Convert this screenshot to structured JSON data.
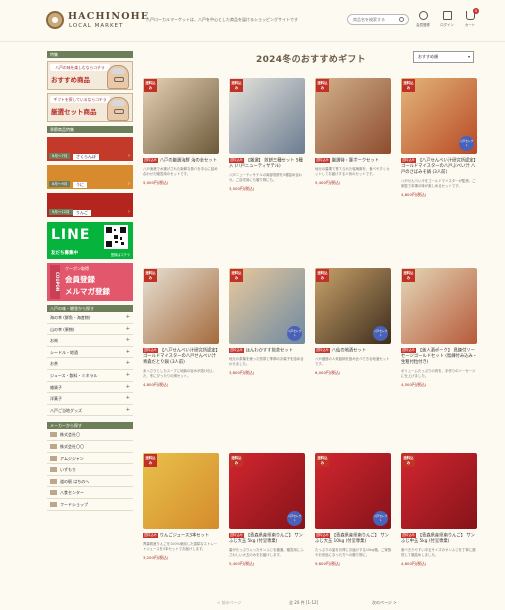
{
  "header": {
    "logo_main": "HACHINOHE",
    "logo_sub": "LOCAL MARKET",
    "description": "八戸ローカルマーケットは、八戸を中心とした商品を届けるショッピングサイトです",
    "search_placeholder": "商品名を検索する",
    "icons": [
      {
        "name": "user-icon",
        "label": "会員登録"
      },
      {
        "name": "logout-icon",
        "label": "ログイン"
      },
      {
        "name": "cart-icon",
        "label": "カート",
        "badge": "0"
      }
    ]
  },
  "sidebar": {
    "feature_head": "特集",
    "banners": [
      {
        "top": "八戸の味を楽しむならコチラ",
        "big": "おすすめ商品"
      },
      {
        "top": "ギフトを探しているならコチラ",
        "big": "厳選セット商品"
      }
    ],
    "season_head": "季節商品特集",
    "seasons": [
      {
        "period": "6月〜7月",
        "name": "さくらんぼ",
        "color": "#c43a2a"
      },
      {
        "period": "8月〜9月",
        "name": "うに",
        "color": "#d88a2e"
      },
      {
        "period": "9月〜12月",
        "name": "りんご",
        "color": "#b5251f"
      }
    ],
    "line": {
      "word": "LINE",
      "bottom": "友だち募集中",
      "qr_caption": "登録はコチラ"
    },
    "coupon": {
      "vertical": "COUPON",
      "top": "クーポン取得",
      "l1": "会員登録",
      "l2": "メルマガ登録"
    },
    "category_head": "八戸の味・贈答から探す",
    "categories": [
      "海の幸 (鮮魚・海産物)",
      "山の幸 (果物)",
      "お肉",
      "シードル・地酒",
      "お茶",
      "ジュース・飲料・ミネラル",
      "雑貨子",
      "洋菓子",
      "八戸ご当地グッズ"
    ],
    "maker_head": "メーカーから探す",
    "makers": [
      "株式会社〇",
      "株式会社〇〇",
      "アムジジャン",
      "いずもり",
      "道の駅 はちのへ",
      "八食センター",
      "フードショップ"
    ]
  },
  "main": {
    "title": "2024冬のおすすめギフト",
    "sort_label": "おすすめ順",
    "ribbon_text": "送料込み",
    "tag_text": "送料込み",
    "stamp_text": "八戸セレクト",
    "products": [
      {
        "name": "八戸の厳選海鮮 海の幸セット",
        "desc": "八戸漁港で水揚げされた新鮮な魚介を中心に詰め合わせた贈答用のセットです。",
        "price": "5,000円(税込)",
        "colors": [
          "#e9d1b6",
          "#6b5a3a"
        ],
        "stamp": false
      },
      {
        "name": "【厳選】 煎餅三種セット 5種入 (八戸ニューティサテル)",
        "desc": "八戸ニューティサテルの南部煎餅を5種詰め合わせ。ご自宅用にも贈り物にも。",
        "price": "3,500円(税込)",
        "colors": [
          "#e7e4dd",
          "#6c7d91"
        ],
        "stamp": false
      },
      {
        "name": "厳選特・豚ボークセット",
        "desc": "地元の農場で育てられた銘柄豚を、食べやすくカットしてお届けする人気のセットです。",
        "price": "5,400円(税込)",
        "colors": [
          "#d3b38c",
          "#8d4c2f"
        ],
        "stamp": false
      },
      {
        "name": "【八戸せんべい汁研究所認定】 ゴールドマイスターの八戸ぶべい汁 八戸のさばみそ鍋 (3人前)",
        "desc": "八戸せんべい汁をゴールドマイスターが監修。ご家庭で本場の味が楽しめるセットです。",
        "price": "4,800円(税込)",
        "colors": [
          "#e3b67a",
          "#b84a25"
        ],
        "stamp": true
      },
      {
        "name": "【八戸せんべい汁研究所認定】 ゴールドマイスターの八戸せんべい汁 青森だとり鍋 (3人前)",
        "desc": "あっさりとしたスープに地鶏の旨みが溶け出した、冬にぴったりの鍋セット。",
        "price": "4,800円(税込)",
        "colors": [
          "#e8e0d4",
          "#a36b3d"
        ],
        "stamp": false
      },
      {
        "name": "ほんわかすす煎茶セット",
        "desc": "地元の茶葉を使った煎茶と季節のお菓子を詰め合わせました。",
        "price": "3,800円(税込)",
        "colors": [
          "#e9c99b",
          "#6e8aa3"
        ],
        "stamp": true
      },
      {
        "name": "八仙の地酒セット",
        "desc": "八戸酒造の人気銘柄を飲み比べできる地酒セットです。",
        "price": "6,000円(税込)",
        "colors": [
          "#c9a26a",
          "#3d2d1d"
        ],
        "stamp": true
      },
      {
        "name": "【美人酒ポーク】 鳥練付ソーセージゴールドセット (鳥練付み込み・生粗付粒付き)",
        "desc": "ボリュームたっぷりの肉を、手作りのソーセージに仕上げました。",
        "price": "4,500円(税込)",
        "colors": [
          "#e4d8b8",
          "#b65a3a"
        ],
        "stamp": false
      },
      {
        "name": "りんごジュース3本セット",
        "desc": "青森県産りんごを100%使用した濃厚なストレートジュースを3本セットでお届けします。",
        "price": "3,200円(税込)",
        "colors": [
          "#e8c14b",
          "#d58b2c"
        ],
        "stamp": false
      },
      {
        "name": "【青森県産県南りんご】 サンふじ大玉 5kg (付呈専業)",
        "desc": "蜜がたっぷり入ったサンふじを厳選。贈答用にふさわしい大玉のみをお届けします。",
        "price": "5,400円(税込)",
        "colors": [
          "#d2262f",
          "#86131a"
        ],
        "stamp": true
      },
      {
        "name": "【青森県産県南りんご】 サンふじ大玉 10kg (付呈専業)",
        "desc": "たっぷりの量をお得にお届けする10kg箱。ご家族やお世話になった方への贈り物に。",
        "price": "9,800円(税込)",
        "colors": [
          "#d2262f",
          "#86131a"
        ],
        "stamp": true
      },
      {
        "name": "【青森県産県南りんご】 サンふじ中玉 5kg (付呈専業)",
        "desc": "食べきりやすい中玉サイズのサンふじを丁寧に選別して箱詰めしました。",
        "price": "4,800円(税込)",
        "colors": [
          "#d2262f",
          "#86131a"
        ],
        "stamp": false
      }
    ],
    "pager": {
      "prev": "< 前のページ",
      "count": "全 20 件 [1-12]",
      "next": "次のページ >"
    }
  }
}
